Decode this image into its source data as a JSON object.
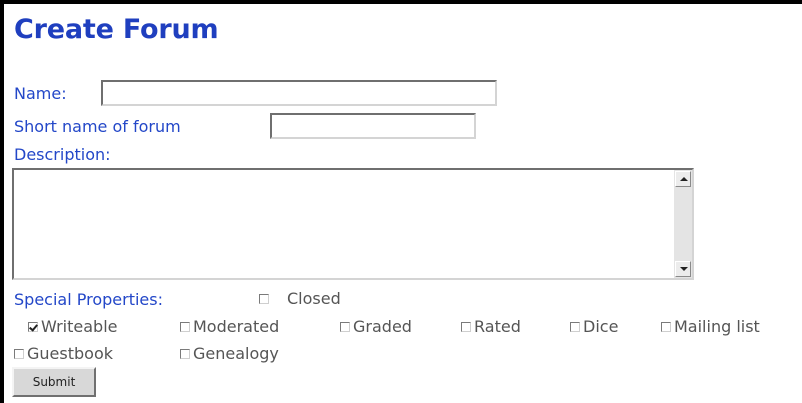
{
  "page": {
    "title": "Create Forum"
  },
  "form": {
    "name_label": "Name:",
    "name_value": "",
    "short_name_label": "Short name of forum",
    "short_name_value": "",
    "description_label": "Description:",
    "description_value": "",
    "special_properties_label": "Special Properties:",
    "properties": [
      {
        "label": "Closed",
        "checked": false
      },
      {
        "label": "Writeable",
        "checked": true
      },
      {
        "label": "Moderated",
        "checked": false
      },
      {
        "label": "Graded",
        "checked": false
      },
      {
        "label": "Rated",
        "checked": false
      },
      {
        "label": "Dice",
        "checked": false
      },
      {
        "label": "Mailing list",
        "checked": false
      },
      {
        "label": "Guestbook",
        "checked": false
      },
      {
        "label": "Genealogy",
        "checked": false
      }
    ],
    "submit_label": "Submit"
  },
  "colors": {
    "label_blue": "#2347c8",
    "title_blue": "#1f3fbf",
    "checkbox_text": "#555555"
  }
}
